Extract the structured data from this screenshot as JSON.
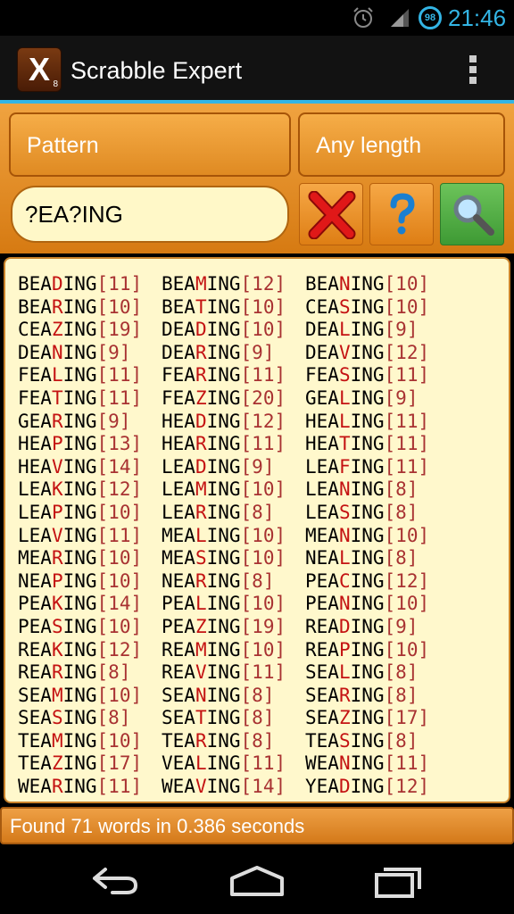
{
  "status": {
    "time": "21:46",
    "battery": "98"
  },
  "app": {
    "title": "Scrabble Expert",
    "icon_letter": "X",
    "icon_sub": "8"
  },
  "controls": {
    "mode": "Pattern",
    "length": "Any length",
    "pattern_value": "?EA?ING"
  },
  "results": [
    {
      "pre": "BEA",
      "red": "D",
      "post": "ING",
      "score": "[11]"
    },
    {
      "pre": "BEA",
      "red": "M",
      "post": "ING",
      "score": "[12]"
    },
    {
      "pre": "BEA",
      "red": "N",
      "post": "ING",
      "score": "[10]"
    },
    {
      "pre": "BEA",
      "red": "R",
      "post": "ING",
      "score": "[10]"
    },
    {
      "pre": "BEA",
      "red": "T",
      "post": "ING",
      "score": "[10]"
    },
    {
      "pre": "CEA",
      "red": "S",
      "post": "ING",
      "score": "[10]"
    },
    {
      "pre": "CEA",
      "red": "Z",
      "post": "ING",
      "score": "[19]"
    },
    {
      "pre": "DEA",
      "red": "D",
      "post": "ING",
      "score": "[10]"
    },
    {
      "pre": "DEA",
      "red": "L",
      "post": "ING",
      "score": "[9]"
    },
    {
      "pre": "DEA",
      "red": "N",
      "post": "ING",
      "score": "[9]"
    },
    {
      "pre": "DEA",
      "red": "R",
      "post": "ING",
      "score": "[9]"
    },
    {
      "pre": "DEA",
      "red": "V",
      "post": "ING",
      "score": "[12]"
    },
    {
      "pre": "FEA",
      "red": "L",
      "post": "ING",
      "score": "[11]"
    },
    {
      "pre": "FEA",
      "red": "R",
      "post": "ING",
      "score": "[11]"
    },
    {
      "pre": "FEA",
      "red": "S",
      "post": "ING",
      "score": "[11]"
    },
    {
      "pre": "FEA",
      "red": "T",
      "post": "ING",
      "score": "[11]"
    },
    {
      "pre": "FEA",
      "red": "Z",
      "post": "ING",
      "score": "[20]"
    },
    {
      "pre": "GEA",
      "red": "L",
      "post": "ING",
      "score": "[9]"
    },
    {
      "pre": "GEA",
      "red": "R",
      "post": "ING",
      "score": "[9]"
    },
    {
      "pre": "HEA",
      "red": "D",
      "post": "ING",
      "score": "[12]"
    },
    {
      "pre": "HEA",
      "red": "L",
      "post": "ING",
      "score": "[11]"
    },
    {
      "pre": "HEA",
      "red": "P",
      "post": "ING",
      "score": "[13]"
    },
    {
      "pre": "HEA",
      "red": "R",
      "post": "ING",
      "score": "[11]"
    },
    {
      "pre": "HEA",
      "red": "T",
      "post": "ING",
      "score": "[11]"
    },
    {
      "pre": "HEA",
      "red": "V",
      "post": "ING",
      "score": "[14]"
    },
    {
      "pre": "LEA",
      "red": "D",
      "post": "ING",
      "score": "[9]"
    },
    {
      "pre": "LEA",
      "red": "F",
      "post": "ING",
      "score": "[11]"
    },
    {
      "pre": "LEA",
      "red": "K",
      "post": "ING",
      "score": "[12]"
    },
    {
      "pre": "LEA",
      "red": "M",
      "post": "ING",
      "score": "[10]"
    },
    {
      "pre": "LEA",
      "red": "N",
      "post": "ING",
      "score": "[8]"
    },
    {
      "pre": "LEA",
      "red": "P",
      "post": "ING",
      "score": "[10]"
    },
    {
      "pre": "LEA",
      "red": "R",
      "post": "ING",
      "score": "[8]"
    },
    {
      "pre": "LEA",
      "red": "S",
      "post": "ING",
      "score": "[8]"
    },
    {
      "pre": "LEA",
      "red": "V",
      "post": "ING",
      "score": "[11]"
    },
    {
      "pre": "MEA",
      "red": "L",
      "post": "ING",
      "score": "[10]"
    },
    {
      "pre": "MEA",
      "red": "N",
      "post": "ING",
      "score": "[10]"
    },
    {
      "pre": "MEA",
      "red": "R",
      "post": "ING",
      "score": "[10]"
    },
    {
      "pre": "MEA",
      "red": "S",
      "post": "ING",
      "score": "[10]"
    },
    {
      "pre": "NEA",
      "red": "L",
      "post": "ING",
      "score": "[8]"
    },
    {
      "pre": "NEA",
      "red": "P",
      "post": "ING",
      "score": "[10]"
    },
    {
      "pre": "NEA",
      "red": "R",
      "post": "ING",
      "score": "[8]"
    },
    {
      "pre": "PEA",
      "red": "C",
      "post": "ING",
      "score": "[12]"
    },
    {
      "pre": "PEA",
      "red": "K",
      "post": "ING",
      "score": "[14]"
    },
    {
      "pre": "PEA",
      "red": "L",
      "post": "ING",
      "score": "[10]"
    },
    {
      "pre": "PEA",
      "red": "N",
      "post": "ING",
      "score": "[10]"
    },
    {
      "pre": "PEA",
      "red": "S",
      "post": "ING",
      "score": "[10]"
    },
    {
      "pre": "PEA",
      "red": "Z",
      "post": "ING",
      "score": "[19]"
    },
    {
      "pre": "REA",
      "red": "D",
      "post": "ING",
      "score": "[9]"
    },
    {
      "pre": "REA",
      "red": "K",
      "post": "ING",
      "score": "[12]"
    },
    {
      "pre": "REA",
      "red": "M",
      "post": "ING",
      "score": "[10]"
    },
    {
      "pre": "REA",
      "red": "P",
      "post": "ING",
      "score": "[10]"
    },
    {
      "pre": "REA",
      "red": "R",
      "post": "ING",
      "score": "[8]"
    },
    {
      "pre": "REA",
      "red": "V",
      "post": "ING",
      "score": "[11]"
    },
    {
      "pre": "SEA",
      "red": "L",
      "post": "ING",
      "score": "[8]"
    },
    {
      "pre": "SEA",
      "red": "M",
      "post": "ING",
      "score": "[10]"
    },
    {
      "pre": "SEA",
      "red": "N",
      "post": "ING",
      "score": "[8]"
    },
    {
      "pre": "SEA",
      "red": "R",
      "post": "ING",
      "score": "[8]"
    },
    {
      "pre": "SEA",
      "red": "S",
      "post": "ING",
      "score": "[8]"
    },
    {
      "pre": "SEA",
      "red": "T",
      "post": "ING",
      "score": "[8]"
    },
    {
      "pre": "SEA",
      "red": "Z",
      "post": "ING",
      "score": "[17]"
    },
    {
      "pre": "TEA",
      "red": "M",
      "post": "ING",
      "score": "[10]"
    },
    {
      "pre": "TEA",
      "red": "R",
      "post": "ING",
      "score": "[8]"
    },
    {
      "pre": "TEA",
      "red": "S",
      "post": "ING",
      "score": "[8]"
    },
    {
      "pre": "TEA",
      "red": "Z",
      "post": "ING",
      "score": "[17]"
    },
    {
      "pre": "VEA",
      "red": "L",
      "post": "ING",
      "score": "[11]"
    },
    {
      "pre": "WEA",
      "red": "N",
      "post": "ING",
      "score": "[11]"
    },
    {
      "pre": "WEA",
      "red": "R",
      "post": "ING",
      "score": "[11]"
    },
    {
      "pre": "WEA",
      "red": "V",
      "post": "ING",
      "score": "[14]"
    },
    {
      "pre": "YEA",
      "red": "D",
      "post": "ING",
      "score": "[12]"
    }
  ],
  "status_message": "Found 71 words in 0.386 seconds",
  "colors": {
    "accent": "#33b5e5",
    "orange": "#e8901f",
    "highlight": "#c41212",
    "result_bg": "#fff8cc"
  }
}
